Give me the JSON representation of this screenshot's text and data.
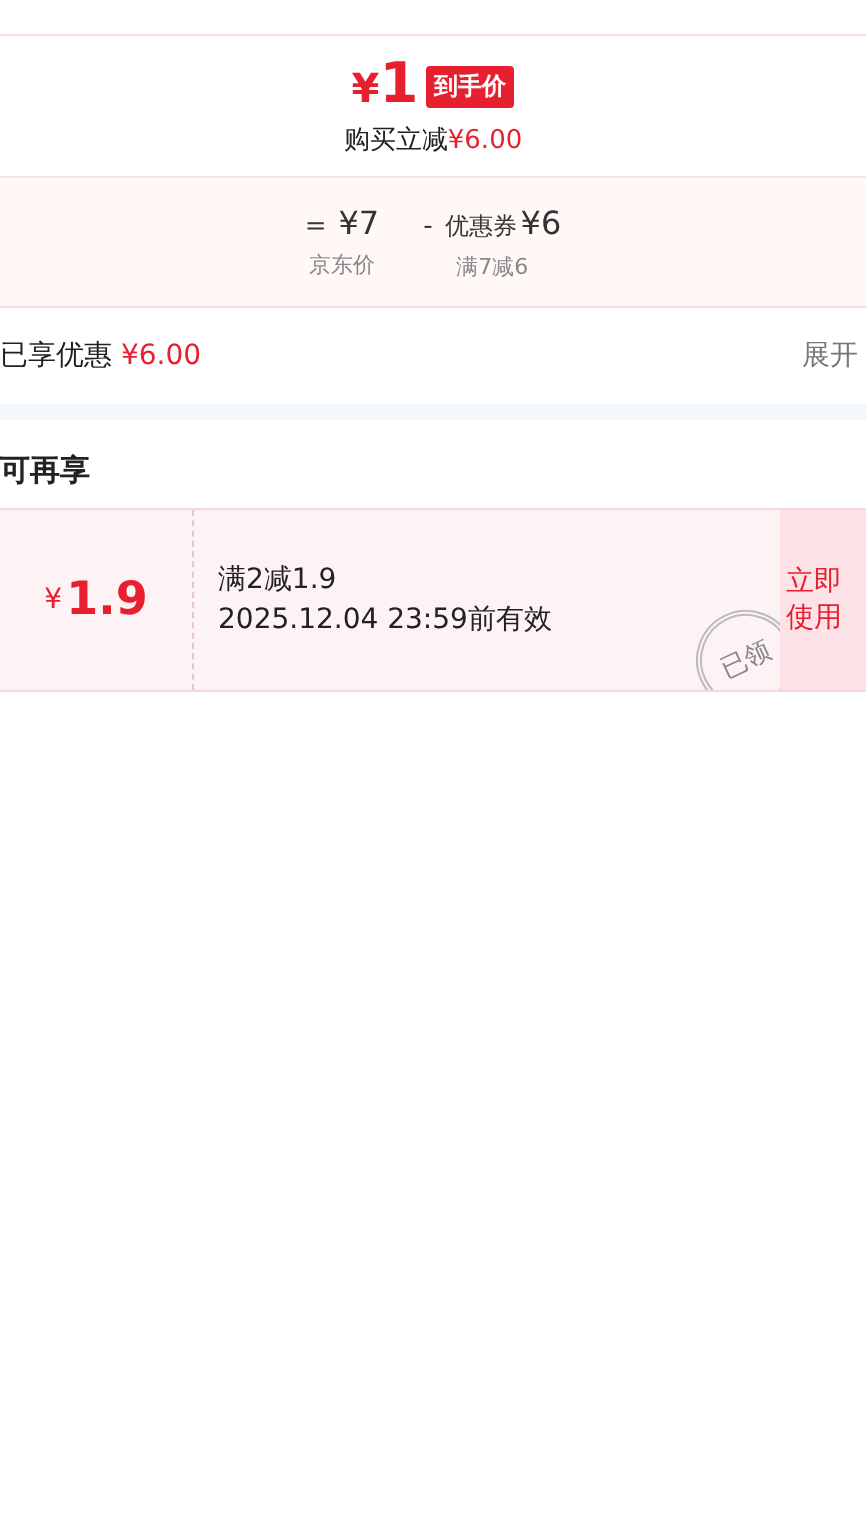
{
  "price": {
    "currency": "¥",
    "amount": "1",
    "badge": "到手价",
    "saving_label": "购买立减",
    "saving_value": "¥6.00"
  },
  "formula": [
    {
      "op": "=",
      "value": "¥7",
      "caption": "京东价"
    },
    {
      "op": "-",
      "prefix": "优惠券",
      "value": "¥6",
      "caption": "满7减6"
    }
  ],
  "enjoyed": {
    "label": "已享优惠",
    "value": "¥6.00",
    "toggle": "展开"
  },
  "more": {
    "title": "可再享",
    "coupons": [
      {
        "currency": "¥",
        "amount": "1.9",
        "condition": "满2减1.9",
        "validity": "2025.12.04 23:59前有效",
        "stamp": "已领",
        "action": "立即使用"
      }
    ]
  }
}
